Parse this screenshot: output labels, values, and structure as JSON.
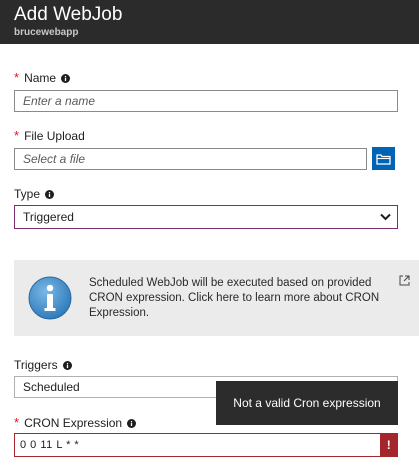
{
  "header": {
    "title": "Add WebJob",
    "subtitle": "brucewebapp"
  },
  "form": {
    "name": {
      "required_mark": "*",
      "label": "Name",
      "placeholder": "Enter a name",
      "info_icon": "info-circle-icon"
    },
    "file_upload": {
      "required_mark": "*",
      "label": "File Upload",
      "placeholder": "Select a file",
      "button_icon": "folder-icon"
    },
    "type": {
      "label": "Type",
      "value": "Triggered",
      "dropdown_icon": "chevron-down-icon"
    },
    "info_box": {
      "icon": "info-icon",
      "text": "Scheduled WebJob will be executed based on provided CRON expression. Click here to learn more about CRON Expression.",
      "link_icon": "external-link-icon"
    },
    "triggers": {
      "label": "Triggers",
      "value": "Scheduled"
    },
    "cron": {
      "required_mark": "*",
      "label": "CRON Expression",
      "value": "0 0 11 L * *",
      "error_badge": "!",
      "error_message": "Not a valid Cron expression"
    }
  },
  "colors": {
    "header_bg": "#2b2b2b",
    "accent_blue": "#0064b4",
    "required_red": "#e81123",
    "error_red": "#a4262c",
    "select_border": "#7a2d72",
    "info_box_bg": "#ebebeb",
    "tooltip_bg": "#2c2c2c"
  }
}
